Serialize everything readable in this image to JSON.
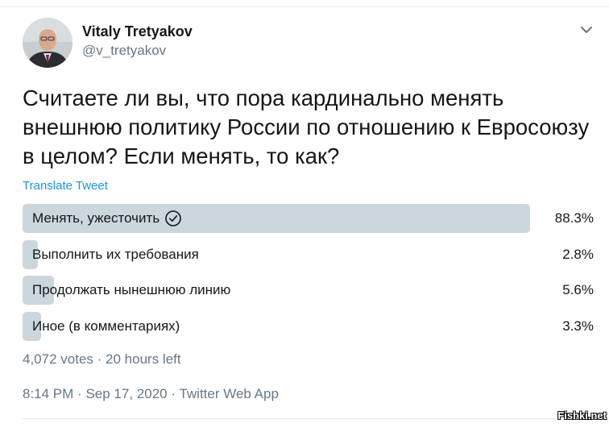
{
  "author": {
    "display_name": "Vitaly Tretyakov",
    "handle": "@v_tretyakov",
    "avatar_icon": "user-avatar-photo"
  },
  "menu_icon": "chevron-down-icon",
  "tweet": {
    "text": "Считаете ли вы, что пора кардинально менять внешнюю политику России по отношению к Евросоюзу в целом? Если менять, то как?",
    "translate_label": "Translate Tweet"
  },
  "poll": {
    "options": [
      {
        "label": "Менять, ужесточить",
        "percent_label": "88.3%",
        "percent": 88.3,
        "selected": true
      },
      {
        "label": "Выполнить их требования",
        "percent_label": "2.8%",
        "percent": 2.8,
        "selected": false
      },
      {
        "label": "Продолжать нынешнюю линию",
        "percent_label": "5.6%",
        "percent": 5.6,
        "selected": false
      },
      {
        "label": "Иное (в комментариях)",
        "percent_label": "3.3%",
        "percent": 3.3,
        "selected": false
      }
    ],
    "votes_label": "4,072 votes",
    "separator": "·",
    "time_left": "20 hours left"
  },
  "meta": {
    "time": "8:14 PM",
    "date": "Sep 17, 2020",
    "separator": "·",
    "source": "Twitter Web App"
  },
  "watermark": "Fishki.net",
  "colors": {
    "accent": "#1b95e0",
    "poll_fill": "#ccd6dd",
    "secondary_text": "#657786",
    "primary_text": "#14171a"
  }
}
